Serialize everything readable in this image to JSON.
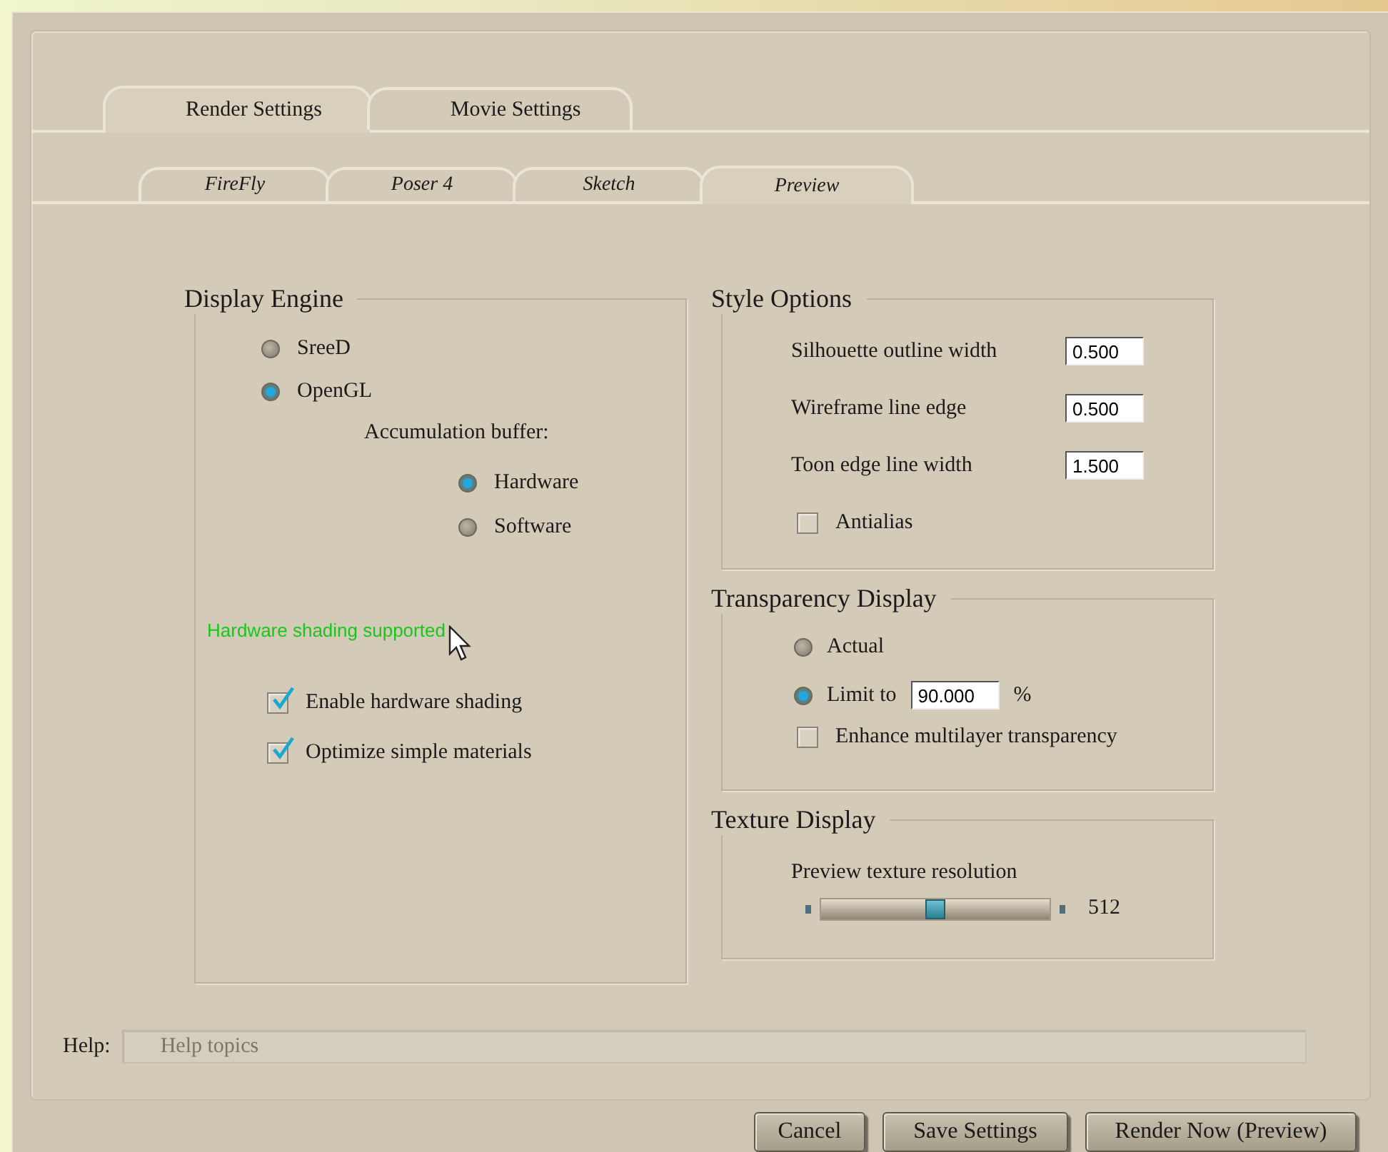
{
  "tabs": [
    {
      "label": "Render Settings",
      "selected": true
    },
    {
      "label": "Movie Settings",
      "selected": false
    }
  ],
  "subtabs": [
    {
      "label": "FireFly",
      "selected": false
    },
    {
      "label": "Poser 4",
      "selected": false
    },
    {
      "label": "Sketch",
      "selected": false
    },
    {
      "label": "Preview",
      "selected": true
    }
  ],
  "display_engine": {
    "title": "Display Engine",
    "engines": [
      {
        "label": "SreeD",
        "selected": false
      },
      {
        "label": "OpenGL",
        "selected": true
      }
    ],
    "accumulation_label": "Accumulation buffer:",
    "accumulation": [
      {
        "label": "Hardware",
        "selected": true
      },
      {
        "label": "Software",
        "selected": false
      }
    ],
    "status": "Hardware shading supported",
    "options": [
      {
        "label": "Enable hardware shading",
        "checked": true
      },
      {
        "label": "Optimize simple materials",
        "checked": true
      }
    ]
  },
  "style_options": {
    "title": "Style Options",
    "fields": [
      {
        "label": "Silhouette outline width",
        "value": "0.500"
      },
      {
        "label": "Wireframe line edge",
        "value": "0.500"
      },
      {
        "label": "Toon edge line width",
        "value": "1.500"
      }
    ],
    "antialias": {
      "label": "Antialias",
      "checked": false
    }
  },
  "transparency": {
    "title": "Transparency Display",
    "modes": [
      {
        "label": "Actual",
        "selected": false
      },
      {
        "label": "Limit to",
        "selected": true,
        "value": "90.000",
        "unit": "%"
      }
    ],
    "enhance": {
      "label": "Enhance multilayer transparency",
      "checked": false
    }
  },
  "texture": {
    "title": "Texture Display",
    "label": "Preview texture resolution",
    "level": 0.5,
    "reading": "512"
  },
  "help": {
    "label": "Help:",
    "placeholder": "Help topics"
  },
  "buttons": [
    "Cancel",
    "Save Settings",
    "Render Now (Preview)"
  ]
}
